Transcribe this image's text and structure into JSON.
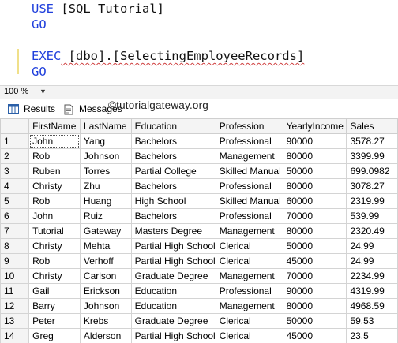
{
  "editor": {
    "lines": [
      {
        "kw": "USE",
        "rest": " [SQL Tutorial]"
      },
      {
        "kw": "GO",
        "rest": ""
      },
      {
        "kw": "EXEC",
        "rest": " [dbo].[SelectingEmployeeRecords]"
      },
      {
        "kw": "GO",
        "rest": ""
      }
    ]
  },
  "zoom": {
    "value": "100 %"
  },
  "tabs": {
    "results": "Results",
    "messages": "Messages"
  },
  "watermark": "©tutorialgateway.org",
  "grid": {
    "columns": [
      "FirstName",
      "LastName",
      "Education",
      "Profession",
      "YearlyIncome",
      "Sales"
    ],
    "rows": [
      [
        "1",
        "John",
        "Yang",
        "Bachelors",
        "Professional",
        "90000",
        "3578.27"
      ],
      [
        "2",
        "Rob",
        "Johnson",
        "Bachelors",
        "Management",
        "80000",
        "3399.99"
      ],
      [
        "3",
        "Ruben",
        "Torres",
        "Partial College",
        "Skilled Manual",
        "50000",
        "699.0982"
      ],
      [
        "4",
        "Christy",
        "Zhu",
        "Bachelors",
        "Professional",
        "80000",
        "3078.27"
      ],
      [
        "5",
        "Rob",
        "Huang",
        "High School",
        "Skilled Manual",
        "60000",
        "2319.99"
      ],
      [
        "6",
        "John",
        "Ruiz",
        "Bachelors",
        "Professional",
        "70000",
        "539.99"
      ],
      [
        "7",
        "Tutorial",
        "Gateway",
        "Masters Degree",
        "Management",
        "80000",
        "2320.49"
      ],
      [
        "8",
        "Christy",
        "Mehta",
        "Partial High School",
        "Clerical",
        "50000",
        "24.99"
      ],
      [
        "9",
        "Rob",
        "Verhoff",
        "Partial High School",
        "Clerical",
        "45000",
        "24.99"
      ],
      [
        "10",
        "Christy",
        "Carlson",
        "Graduate Degree",
        "Management",
        "70000",
        "2234.99"
      ],
      [
        "11",
        "Gail",
        "Erickson",
        "Education",
        "Professional",
        "90000",
        "4319.99"
      ],
      [
        "12",
        "Barry",
        "Johnson",
        "Education",
        "Management",
        "80000",
        "4968.59"
      ],
      [
        "13",
        "Peter",
        "Krebs",
        "Graduate Degree",
        "Clerical",
        "50000",
        "59.53"
      ],
      [
        "14",
        "Greg",
        "Alderson",
        "Partial High School",
        "Clerical",
        "45000",
        "23.5"
      ]
    ]
  }
}
